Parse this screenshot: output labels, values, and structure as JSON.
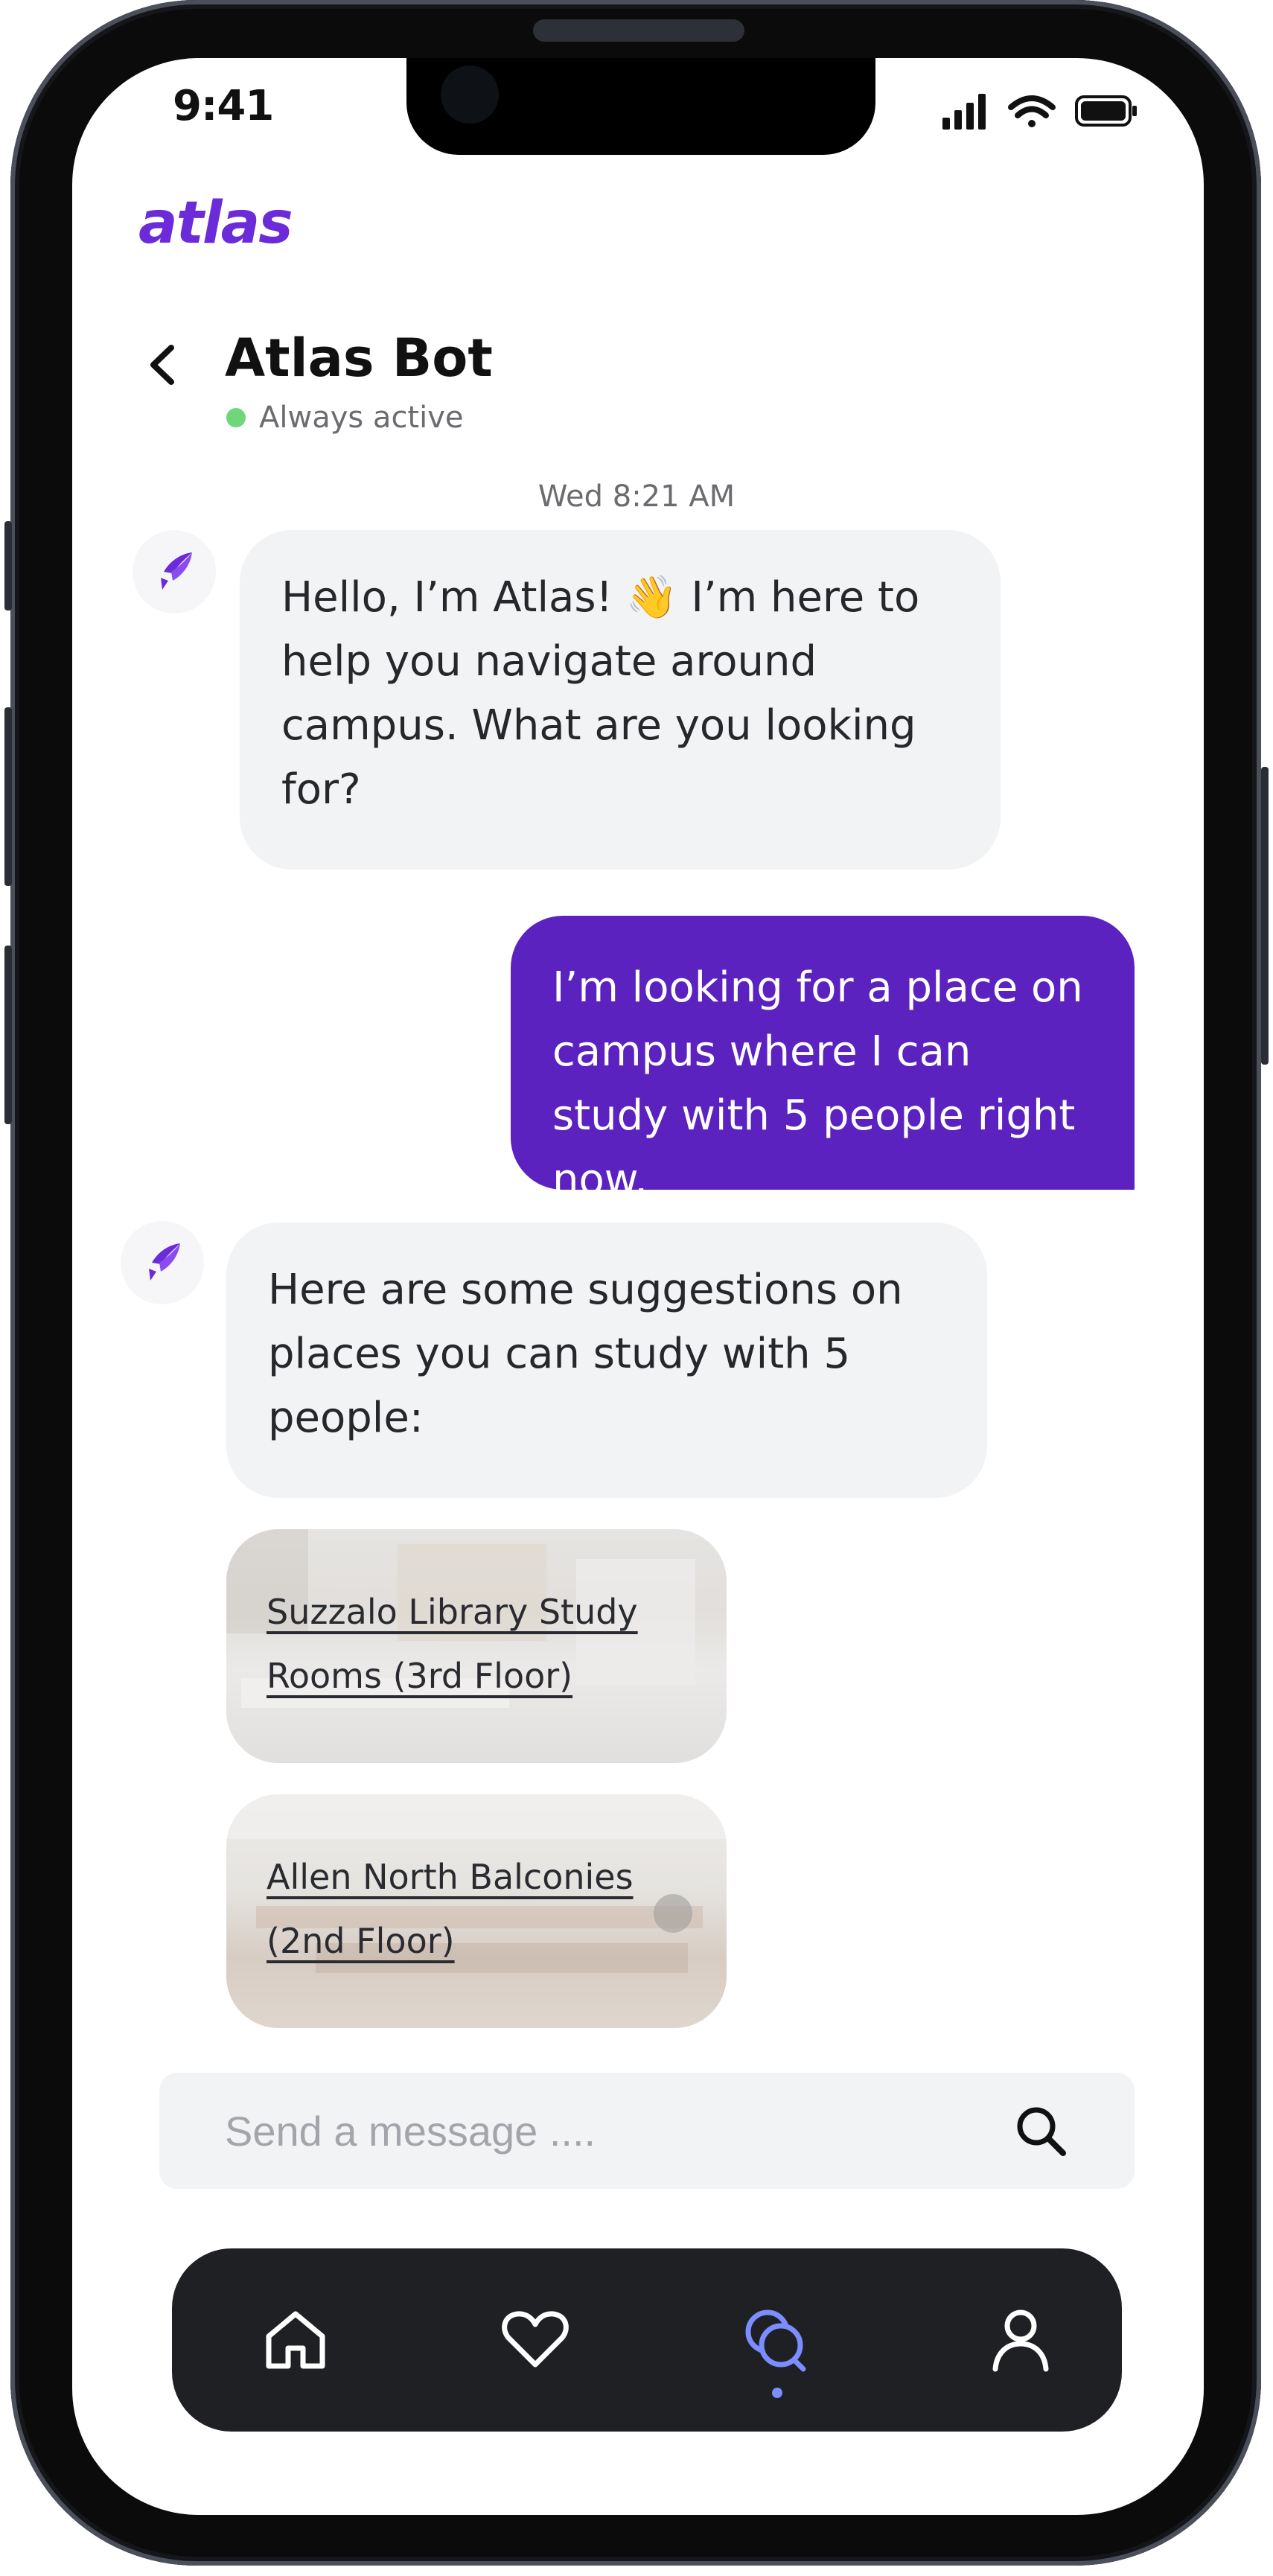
{
  "status_bar": {
    "time": "9:41"
  },
  "app": {
    "logo": "atlas",
    "brand_color": "#6c2bd9"
  },
  "header": {
    "title": "Atlas Bot",
    "status": "Always active",
    "status_color": "#6fd67a"
  },
  "chat": {
    "timestamp": "Wed 8:21 AM",
    "messages": [
      {
        "sender": "bot",
        "text": "Hello, I’m Atlas! 👋 I’m here to help you navigate around campus. What are you looking for?"
      },
      {
        "sender": "user",
        "text": "I’m looking for a place on campus where I can study with 5 people right now."
      },
      {
        "sender": "bot",
        "text": "Here are some suggestions on places you can study with 5 people:"
      }
    ],
    "suggestions": [
      {
        "label": "Suzzalo Library Study Rooms (3rd Floor)"
      },
      {
        "label": "Allen North Balconies (2nd Floor)"
      }
    ]
  },
  "composer": {
    "placeholder": "Send a message ....",
    "value": ""
  },
  "nav": {
    "items": [
      {
        "icon": "home-icon",
        "active": false
      },
      {
        "icon": "heart-icon",
        "active": false
      },
      {
        "icon": "chat-icon",
        "active": true
      },
      {
        "icon": "profile-icon",
        "active": false
      }
    ],
    "active_color": "#7b8dff"
  }
}
